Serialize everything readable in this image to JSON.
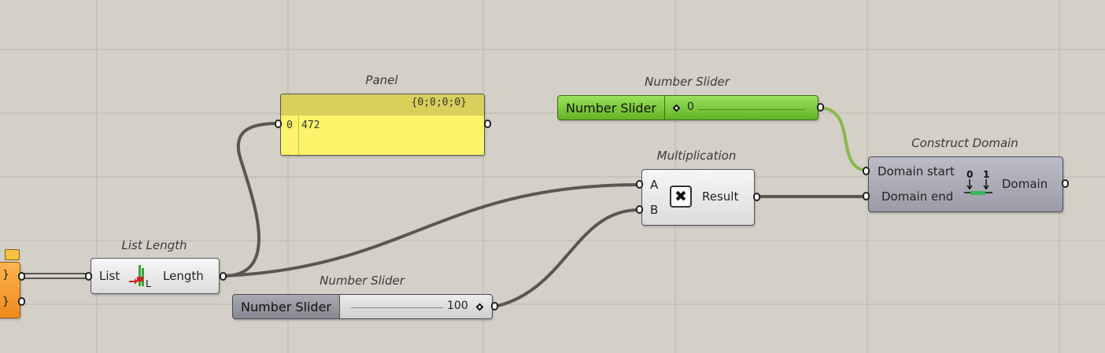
{
  "canvas": {
    "background": "#d4d0c8",
    "grid_color": "#bcb8b1",
    "wire_color": "#5a5752",
    "wire_selected_color": "#8ab84f"
  },
  "list_length": {
    "name": "List Length",
    "input": "List",
    "output": "Length",
    "icon": "list-length-icon"
  },
  "panel": {
    "name": "Panel",
    "path": "{0;0;0;0}",
    "index": "0",
    "value": "472",
    "color": "#fbf46a"
  },
  "slider_top": {
    "name": "Number Slider",
    "label": "Number Slider",
    "value": "0",
    "color": "#7acb3c"
  },
  "slider_bottom": {
    "name": "Number Slider",
    "label": "Number Slider",
    "value": "100",
    "color": "#8c8c94"
  },
  "multiplication": {
    "name": "Multiplication",
    "input_a": "A",
    "input_b": "B",
    "output": "Result",
    "icon": "multiply-icon"
  },
  "construct_domain": {
    "name": "Construct Domain",
    "input_start": "Domain start",
    "input_end": "Domain end",
    "output": "Domain",
    "icon": "construct-domain-icon",
    "icon_text_0": "0",
    "icon_text_1": "1"
  },
  "left_component": {
    "color": "#f59d2a",
    "row1": "}",
    "row2": "}"
  }
}
